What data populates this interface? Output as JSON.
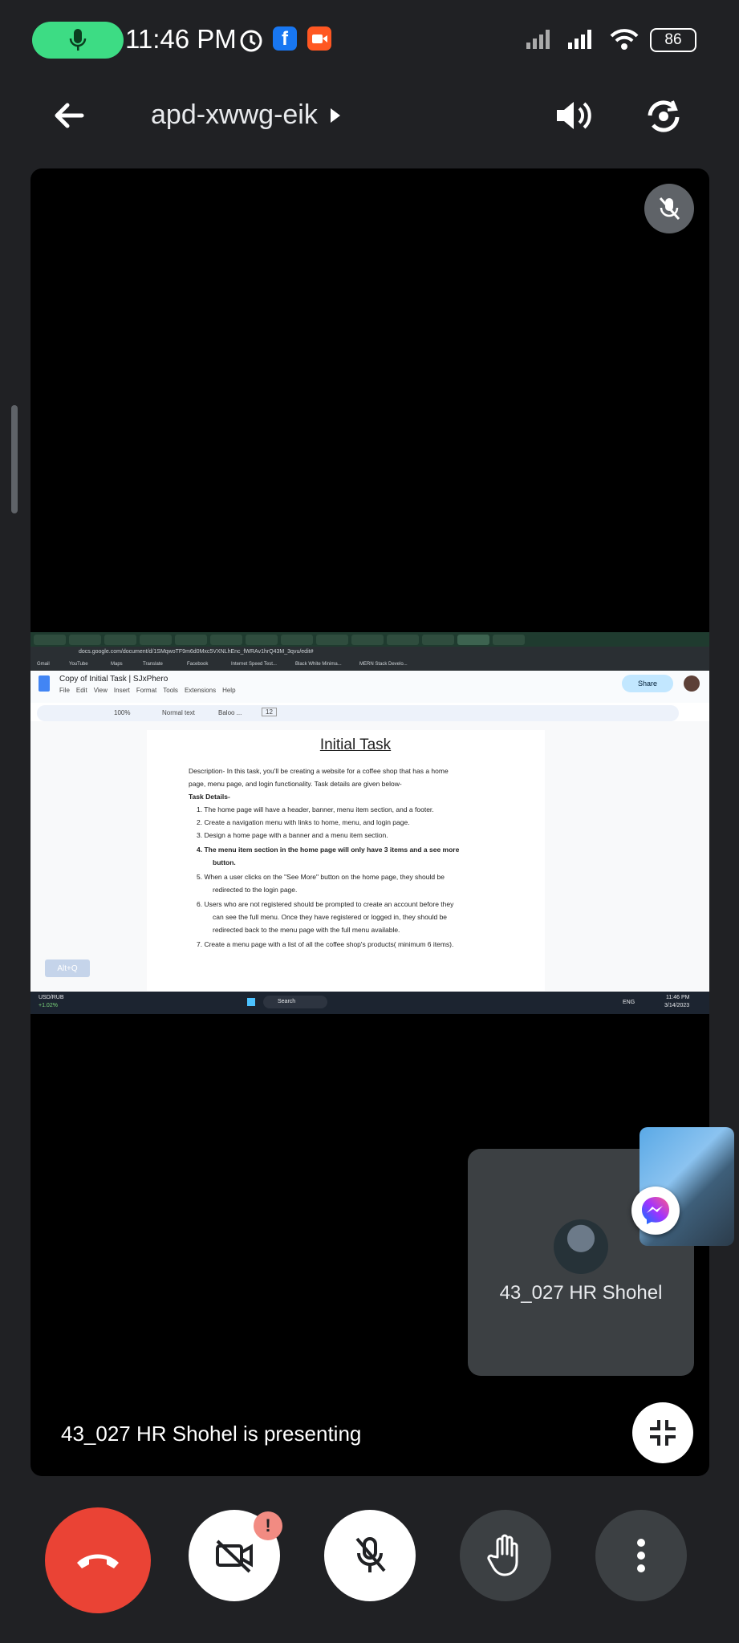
{
  "status_bar": {
    "time": "11:46 PM",
    "battery": "86",
    "icons": [
      "mic-icon",
      "alarm-icon",
      "facebook-icon",
      "video-record-icon",
      "signal-icon",
      "signal-icon",
      "wifi-icon",
      "battery-icon"
    ]
  },
  "header": {
    "meeting_code": "apd-xwwg-eik",
    "icons": [
      "back-arrow-icon",
      "play-triangle-icon",
      "speaker-icon",
      "switch-camera-icon"
    ]
  },
  "shared_screen": {
    "doc_name": "Copy of Initial Task | SJxPhero",
    "menu": [
      "File",
      "Edit",
      "View",
      "Insert",
      "Format",
      "Tools",
      "Extensions",
      "Help"
    ],
    "share_label": "Share",
    "url": "docs.google.com/document/d/1SMqwoTF9m6d0Mxc5VXNLhEnc_fWRAv1hrQ43M_3qvu/edit#",
    "bookmarks": [
      "Gmail",
      "YouTube",
      "Maps",
      "Translate",
      "Facebook",
      "Internet Speed Test...",
      "Black White Minima...",
      "MERN Stack Develo..."
    ],
    "toolbar": {
      "zoom": "100%",
      "style": "Normal text",
      "font": "Baloo ...",
      "size": "12"
    },
    "doc_title": "Initial Task",
    "paragraphs": [
      "Description- In this task, you'll be creating a website for a coffee shop that has a home",
      "page, menu page, and login functionality. Task details are given below-",
      "Task Details-",
      "1.   The home page will have a header, banner, menu item section, and a footer.",
      "2.   Create a navigation menu with links to home, menu, and login page.",
      "3.   Design a home page with a banner and a menu item section.",
      "4.   The menu item section in the home page will only have 3 items and a see more",
      "button.",
      "5.   When a user clicks on the \"See More\" button on the home page, they should be",
      "redirected to the login page.",
      "6.   Users who are not registered should be prompted to create an account before they",
      "can see the full menu. Once they have registered or logged in, they should be",
      "redirected back to the menu page with the full menu available.",
      "7.   Create a menu page with a list of all the coffee shop's products( minimum 6 items)."
    ],
    "alt_hint": "Alt+Q",
    "taskbar": {
      "ticker": "USD/RUB",
      "ticker_change": "+1.02%",
      "search": "Search",
      "lang": "ENG",
      "time": "11:46 PM",
      "date": "3/14/2023"
    }
  },
  "participant_tile": {
    "name": "43_027 HR Shohel"
  },
  "presenting_text": "43_027 HR Shohel is presenting",
  "controls": {
    "badge": "!",
    "icons": [
      "hang-up-icon",
      "camera-off-icon",
      "mic-off-icon",
      "raise-hand-icon",
      "more-icon"
    ]
  },
  "colors": {
    "hangup": "#ea4335",
    "accent": "#3ddc84",
    "surface": "#3c4043"
  }
}
